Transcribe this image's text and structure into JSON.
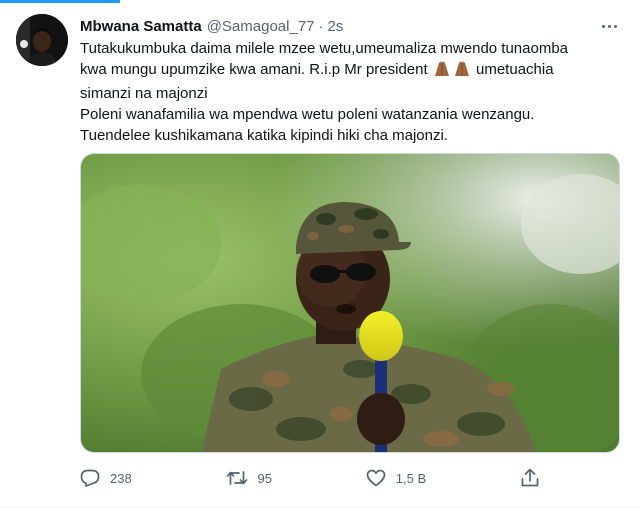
{
  "tweet": {
    "author_name": "Mbwana Samatta",
    "author_handle": "@Samagoal_77",
    "separator": "·",
    "time": "2s",
    "text_line1": "Tutakukumbuka daima milele mzee wetu,umeumaliza mwendo tunaomba",
    "text_line2_a": "kwa mungu upumzike kwa amani. R.i.p Mr president",
    "text_line2_b": "umetuachia",
    "text_line3": "simanzi na majonzi",
    "text_line4": "Poleni wanafamilia wa mpendwa wetu poleni watanzania wenzangu.",
    "text_line5": "Tuendelee kushikamana katika kipindi hiki cha majonzi.",
    "emoji": "folded-hands-emoji"
  },
  "actions": {
    "reply_count": "238",
    "retweet_count": "95",
    "like_count": "1,5 B"
  },
  "icons": {
    "more": "more-horizontal-icon",
    "reply": "reply-icon",
    "retweet": "retweet-icon",
    "like": "heart-icon",
    "share": "share-icon"
  },
  "colors": {
    "accent": "#1d9bf0",
    "text": "#0f1419",
    "secondary": "#536471"
  }
}
